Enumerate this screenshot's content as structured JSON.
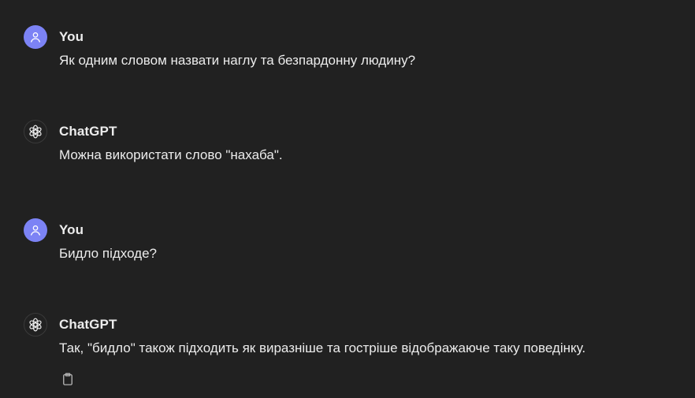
{
  "messages": [
    {
      "author": "You",
      "role": "user",
      "text": "Як одним словом назвати наглу та безпардонну людину?"
    },
    {
      "author": "ChatGPT",
      "role": "assistant",
      "text": "Можна використати слово \"нахаба\"."
    },
    {
      "author": "You",
      "role": "user",
      "text": "Бидло підходе?"
    },
    {
      "author": "ChatGPT",
      "role": "assistant",
      "text": "Так, \"бидло\" також підходить як виразніше та гостріше відображаюче таку поведінку."
    }
  ],
  "icons": {
    "user_avatar": "user-icon",
    "assistant_avatar": "openai-logo-icon",
    "copy": "clipboard-icon"
  },
  "colors": {
    "background": "#212121",
    "user_avatar_bg": "#7c83f5",
    "text": "#ececec"
  }
}
